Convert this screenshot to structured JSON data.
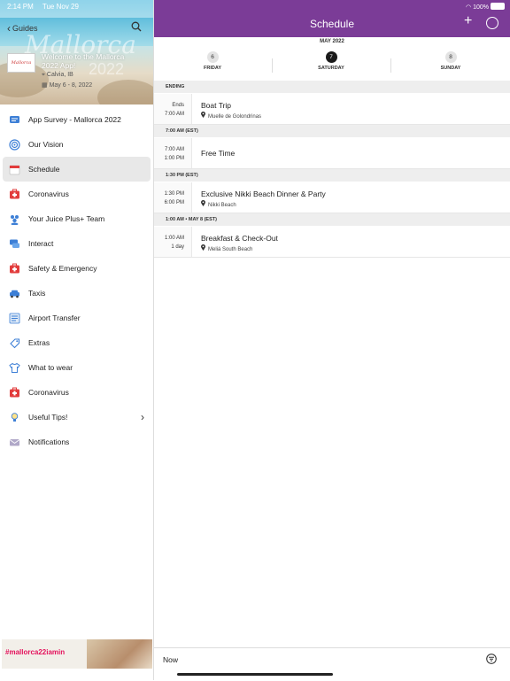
{
  "status": {
    "time": "2:14 PM",
    "date": "Tue Nov 29",
    "battery": "100%"
  },
  "sidebar": {
    "back_label": "Guides",
    "banner": {
      "logo_text": "Mallorca",
      "script_text": "Mallorca",
      "year_text": "2022",
      "welcome": "Welcome to the Mallorca 2022 App!",
      "location": "Calvia, IB",
      "dates": "May 6 - 8, 2022"
    },
    "items": [
      {
        "label": "App Survey - Mallorca 2022",
        "icon": "survey-icon",
        "color": "#3d7fd6"
      },
      {
        "label": "Our Vision",
        "icon": "target-icon",
        "color": "#3d7fd6"
      },
      {
        "label": "Schedule",
        "icon": "calendar-icon",
        "color": "#e23c3c"
      },
      {
        "label": "Coronavirus",
        "icon": "first-aid-icon",
        "color": "#e23c3c"
      },
      {
        "label": "Your Juice Plus+ Team",
        "icon": "team-icon",
        "color": "#3d7fd6"
      },
      {
        "label": "Interact",
        "icon": "chat-icon",
        "color": "#3d7fd6"
      },
      {
        "label": "Safety & Emergency",
        "icon": "first-aid-icon",
        "color": "#e23c3c"
      },
      {
        "label": "Taxis",
        "icon": "taxi-icon",
        "color": "#3d7fd6"
      },
      {
        "label": "Airport Transfer",
        "icon": "list-icon",
        "color": "#3d7fd6"
      },
      {
        "label": "Extras",
        "icon": "tag-icon",
        "color": "#3d7fd6"
      },
      {
        "label": "What to wear",
        "icon": "shirt-icon",
        "color": "#3d7fd6"
      },
      {
        "label": "Coronavirus",
        "icon": "first-aid-icon",
        "color": "#e23c3c"
      },
      {
        "label": "Useful Tips!",
        "icon": "lightbulb-icon",
        "color": "#3d7fd6"
      },
      {
        "label": "Notifications",
        "icon": "envelope-icon",
        "color": "#b0a8c8"
      }
    ],
    "active_index": 2,
    "ad_text": "#mallorca22iamin"
  },
  "header": {
    "title": "Schedule",
    "accent": "#7b3c97"
  },
  "calendar": {
    "month": "MAY 2022",
    "days": [
      {
        "num": "6",
        "name": "FRIDAY",
        "selected": false
      },
      {
        "num": "7",
        "name": "SATURDAY",
        "selected": true
      },
      {
        "num": "8",
        "name": "SUNDAY",
        "selected": false
      }
    ]
  },
  "schedule": [
    {
      "section": "ENDING",
      "events": [
        {
          "time1": "Ends",
          "time2": "7:00 AM",
          "title": "Boat Trip",
          "location": "Muelle de Golondrinas"
        }
      ]
    },
    {
      "section": "7:00 AM (EST)",
      "events": [
        {
          "time1": "7:00 AM",
          "time2": "1:00 PM",
          "title": "Free Time",
          "location": ""
        }
      ]
    },
    {
      "section": "1:30 PM (EST)",
      "events": [
        {
          "time1": "1:30 PM",
          "time2": "6:00 PM",
          "title": "Exclusive Nikki Beach Dinner & Party",
          "location": "Nikki Beach"
        }
      ]
    },
    {
      "section": "1:00 AM • MAY 8 (EST)",
      "events": [
        {
          "time1": "1:00 AM",
          "time2": "1 day",
          "title": "Breakfast & Check-Out",
          "location": "Meliá South Beach"
        }
      ]
    }
  ],
  "footer": {
    "now_label": "Now"
  }
}
